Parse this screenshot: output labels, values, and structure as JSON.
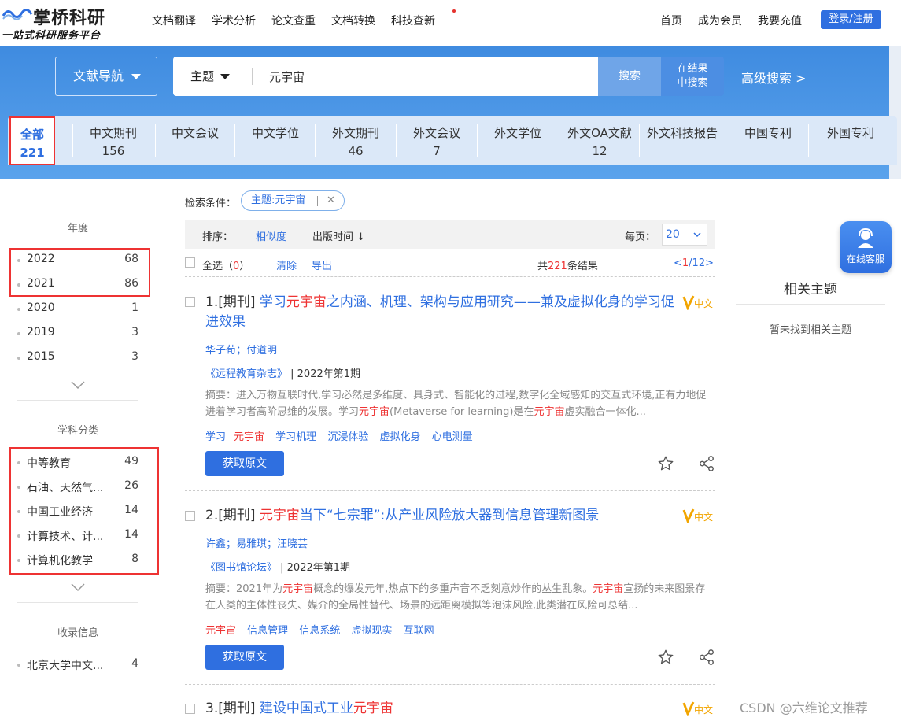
{
  "header": {
    "logo_title": "掌桥科研",
    "logo_sub": "一站式科研服务平台",
    "nav": [
      "文档翻译",
      "学术分析",
      "论文查重",
      "文档转换",
      "科技查新"
    ],
    "nav_right": [
      "首页",
      "成为会员",
      "我要充值"
    ],
    "login": "登录/注册"
  },
  "search": {
    "doc_nav": "文献导航",
    "field": "主题",
    "query": "元宇宙",
    "search_btn": "搜索",
    "in_result_line1": "在结果",
    "in_result_line2": "中搜索",
    "advanced": "高级搜索 >"
  },
  "tabs": [
    {
      "label": "全部",
      "count": "221",
      "active": true
    },
    {
      "label": "中文期刊",
      "count": "156"
    },
    {
      "label": "中文会议",
      "count": ""
    },
    {
      "label": "中文学位",
      "count": ""
    },
    {
      "label": "外文期刊",
      "count": "46"
    },
    {
      "label": "外文会议",
      "count": "7"
    },
    {
      "label": "外文学位",
      "count": ""
    },
    {
      "label": "外文OA文献",
      "count": "12"
    },
    {
      "label": "外文科技报告",
      "count": ""
    },
    {
      "label": "中国专利",
      "count": ""
    },
    {
      "label": "外国专利",
      "count": ""
    }
  ],
  "sidebar": {
    "year_head": "年度",
    "years": [
      {
        "label": "2022",
        "count": "68"
      },
      {
        "label": "2021",
        "count": "86"
      },
      {
        "label": "2020",
        "count": "1"
      },
      {
        "label": "2019",
        "count": "3"
      },
      {
        "label": "2015",
        "count": "3"
      }
    ],
    "subject_head": "学科分类",
    "subjects": [
      {
        "label": "中等教育",
        "count": "49"
      },
      {
        "label": "石油、天然气...",
        "count": "26"
      },
      {
        "label": "中国工业经济",
        "count": "14"
      },
      {
        "label": "计算技术、计...",
        "count": "14"
      },
      {
        "label": "计算机化教学",
        "count": "8"
      }
    ],
    "index_head": "收录信息",
    "indexes": [
      {
        "label": "北京大学中文...",
        "count": "4"
      }
    ]
  },
  "criteria": {
    "label": "检索条件：",
    "tag": "主题:元宇宙"
  },
  "sort": {
    "label": "排序：",
    "relevance": "相似度",
    "time": "出版时间 ↓",
    "per_page_label": "每页：",
    "per_page": "20"
  },
  "select": {
    "all": "全选（",
    "all_count": "0",
    "all_end": "）",
    "clear": "清除",
    "export": "导出",
    "total_pre": "共",
    "total": "221",
    "total_post": "条结果",
    "pager_prev": "<",
    "pager_cur": "1",
    "pager_rest": "/12>"
  },
  "results": [
    {
      "num": "1.[期刊] ",
      "t1": "学习",
      "t2": "元宇宙",
      "t3": "之内涵、机理、架构与应用研究——兼及虚拟化身的学习促进效果",
      "authors": "华子荀；付道明",
      "journal": "《远程教育杂志》",
      "issue": " | 2022年第1期",
      "abs1": "摘要：进入万物互联时代,学习必然是多维度、具身式、智能化的过程,数字化全域感知的交互式环境,正有力地促进着学习者高阶思维的发展。学习",
      "abs2": "元宇宙",
      "abs3": "(Metaverse for learning)是在",
      "abs4": "元宇宙",
      "abs5": "虚实融合一体化...",
      "kw_pre": "学习",
      "kw_hl": "元宇宙",
      "keywords": [
        "学习机理",
        "沉浸体验",
        "虚拟化身",
        "心电测量"
      ],
      "btn": "获取原文",
      "badge": "中文"
    },
    {
      "num": "2.[期刊] ",
      "t1": "",
      "t2": "元宇宙",
      "t3": "当下“七宗罪”:从产业风险放大器到信息管理新图景",
      "authors": "许鑫；易雅琪；汪晓芸",
      "journal": "《图书馆论坛》",
      "issue": " | 2022年第1期",
      "abs1": "摘要：2021年为",
      "abs2": "元宇宙",
      "abs3": "概念的爆发元年,热点下的多重声音不乏刻意炒作的丛生乱象。",
      "abs4": "元宇宙",
      "abs5": "宣扬的未来图景存在人类的主体性丧失、媒介的全局性替代、场景的远距离模拟等泡沫风险,此类潜在风险可总结...",
      "kw_pre": "",
      "kw_hl": "元宇宙",
      "keywords": [
        "信息管理",
        "信息系统",
        "虚拟现实",
        "互联网"
      ],
      "btn": "获取原文",
      "badge": "中文"
    },
    {
      "num": "3.[期刊] ",
      "t1": "建设中国式工业",
      "t2": "元宇宙",
      "t3": "",
      "badge": "中文"
    }
  ],
  "right": {
    "service": "在线客服",
    "related_title": "相关主题",
    "related_empty": "暂未找到相关主题"
  },
  "watermark": "CSDN @六维论文推荐",
  "colors": {
    "accent": "#2f6fe0",
    "highlight": "#e33333",
    "band": "#4a95e6"
  }
}
